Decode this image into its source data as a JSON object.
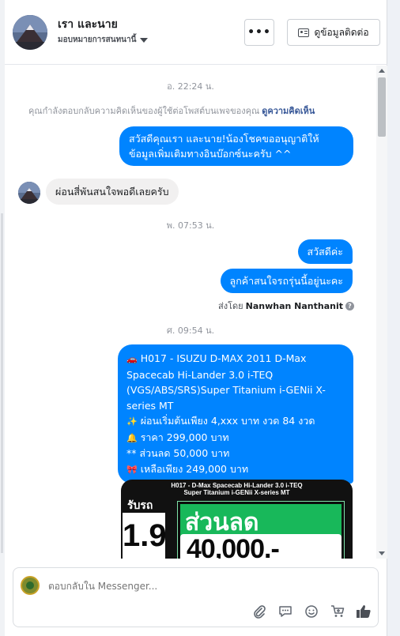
{
  "header": {
    "name": "เรา และนาย",
    "subtitle": "มอบหมายการสนทนานี้",
    "more_label": "•••",
    "contact_label": "ดูข้อมูลติดต่อ"
  },
  "conversation": {
    "timestamp1": "อ. 22:24 น.",
    "comment_note": "คุณกำลังตอบกลับความคิดเห็นของผู้ใช้ต่อโพสต์บนเพจของคุณ",
    "comment_link": "ดูความคิดเห็น",
    "msg1_line1": "สวัสดีคุณเรา และนาย!น้องโชคขออนุญาติให้",
    "msg1_line2": "ข้อมูลเพิ่มเติมทางอินบ๊อกซ์นะครับ ^^",
    "msg2": "ผ่อนสี่พันสนใจพอดีเลยครับ",
    "timestamp2": "พ. 07:53 น.",
    "msg3": "สวัสดีค่ะ",
    "msg4": "ลูกค้าสนใจรถรุ่นนี้อยู่นะคะ",
    "sentby_prefix": "ส่งโดย",
    "sentby_name": "Nanwhan Nanthanit",
    "timestamp3": "ศ. 09:54 น.",
    "msg5": {
      "line1": "H017 - ISUZU D-MAX 2011 D-Max",
      "line2": "Spacecab Hi-Lander 3.0 i-TEQ",
      "line3": "(VGS/ABS/SRS)Super Titanium i-GENii X-",
      "line4": "series MT",
      "line5": "ผ่อนเริ่มต้นเพียง 4,xxx บาท งวด 84 งวด",
      "line6": "ราคา 299,000 บาท",
      "line7": "** ส่วนลด 50,000 บาท",
      "line8": "เหลือเพียง 249,000 บาท"
    },
    "ad_image": {
      "top_line1": "H017 - D-Max Spacecab Hi-Lander 3.0 i-TEQ",
      "top_line2": "Super Titanium i-GENii X-series MT",
      "label_left": "รับรถ",
      "left_big": "1.9",
      "green_title": "ส่วนลด",
      "green_value": "40,000.-"
    }
  },
  "composer": {
    "placeholder": "ตอบกลับใน Messenger..."
  }
}
